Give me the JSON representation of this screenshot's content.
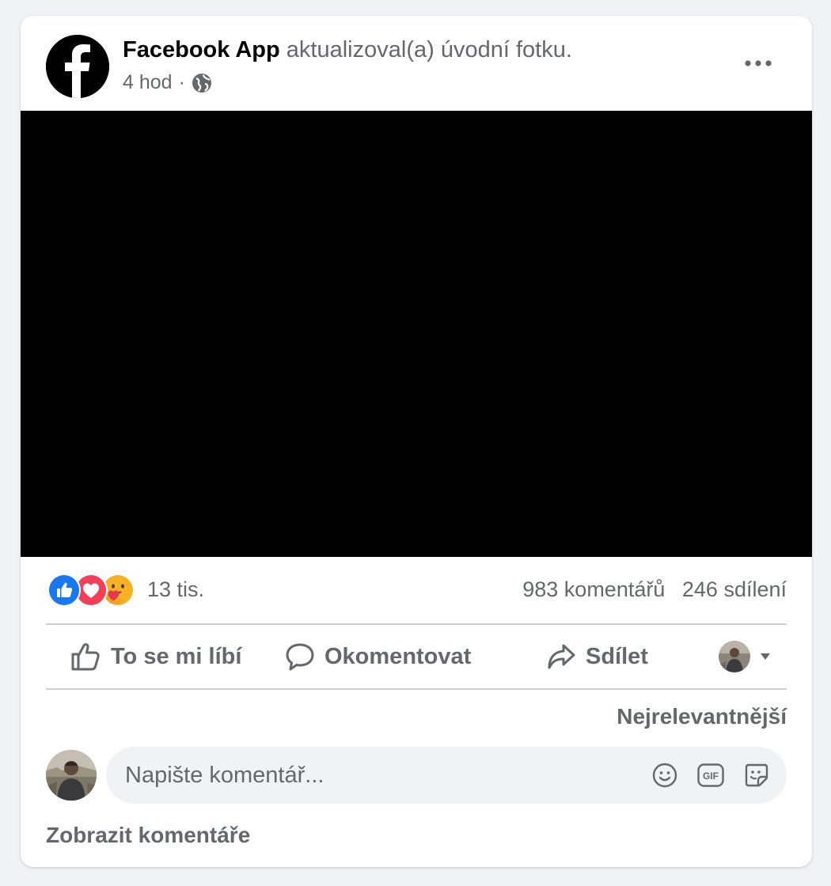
{
  "post": {
    "page_name": "Facebook App",
    "action": "aktualizoval(a) úvodní fotku.",
    "time": "4 hod",
    "separator": "·",
    "privacy_icon": "globe-icon",
    "photo_background": "#000000"
  },
  "stats": {
    "reactions": [
      "like",
      "love",
      "care"
    ],
    "reaction_count": "13 tis.",
    "comments": "983 komentářů",
    "shares": "246 sdílení"
  },
  "actions": {
    "like_label": "To se mi líbí",
    "comment_label": "Okomentovat",
    "share_label": "Sdílet"
  },
  "comments": {
    "sort_label": "Nejrelevantnější",
    "input_placeholder": "Napište komentář...",
    "view_label": "Zobrazit komentáře"
  },
  "colors": {
    "like_blue": "#1877f2",
    "love_red": "#f33e58",
    "care_yellow": "#f7b125",
    "secondary_text": "#65676b"
  }
}
